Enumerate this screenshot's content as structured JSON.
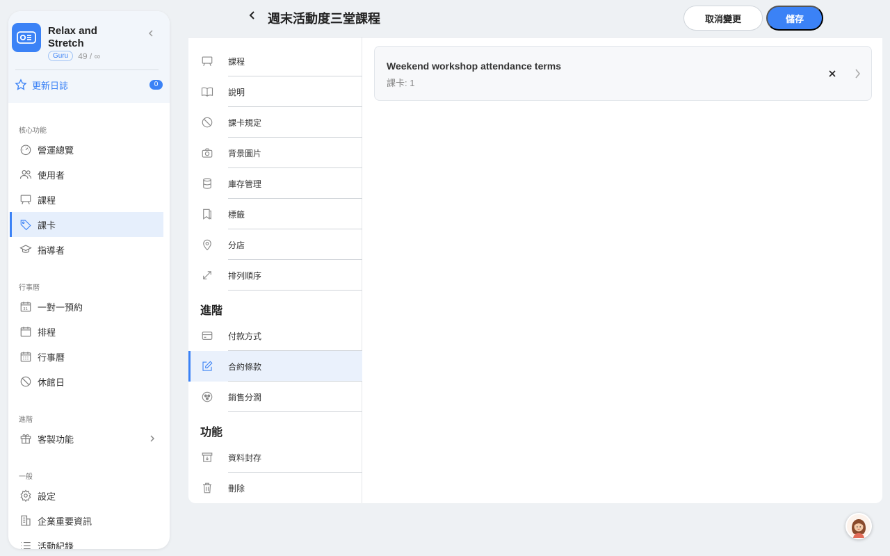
{
  "sidebar": {
    "app_name": "Relax and Stretch",
    "plan_badge": "Guru",
    "plan_count": "49 / ∞",
    "changelog_label": "更新日誌",
    "changelog_count": "0",
    "sections": {
      "core": "核心功能",
      "calendar": "行事曆",
      "advanced": "進階",
      "general": "一般"
    },
    "items": [
      {
        "label": "營運總覽",
        "icon": "dashboard-icon"
      },
      {
        "label": "使用者",
        "icon": "users-icon"
      },
      {
        "label": "課程",
        "icon": "presentation-icon"
      },
      {
        "label": "課卡",
        "icon": "tag-icon"
      },
      {
        "label": "指導者",
        "icon": "graduation-cap-icon"
      },
      {
        "label": "一對一預約",
        "icon": "calendar-31-icon"
      },
      {
        "label": "排程",
        "icon": "calendar-icon"
      },
      {
        "label": "行事曆",
        "icon": "calendar-grid-icon"
      },
      {
        "label": "休館日",
        "icon": "prohibited-icon"
      },
      {
        "label": "客製功能",
        "icon": "gift-icon"
      },
      {
        "label": "設定",
        "icon": "gear-icon"
      },
      {
        "label": "企業重要資訊",
        "icon": "building-icon"
      },
      {
        "label": "活動紀錄",
        "icon": "list-icon"
      }
    ]
  },
  "header": {
    "title": "週末活動度三堂課程",
    "cancel_label": "取消變更",
    "save_label": "儲存"
  },
  "settings_nav": {
    "items": [
      {
        "label": "課程",
        "icon": "presentation-icon"
      },
      {
        "label": "說明",
        "icon": "book-icon"
      },
      {
        "label": "課卡規定",
        "icon": "prohibited-icon"
      },
      {
        "label": "背景圖片",
        "icon": "camera-icon"
      },
      {
        "label": "庫存管理",
        "icon": "database-icon"
      },
      {
        "label": "標籤",
        "icon": "bookmark-icon"
      },
      {
        "label": "分店",
        "icon": "map-pin-icon"
      },
      {
        "label": "排列順序",
        "icon": "resize-icon"
      }
    ],
    "advanced_heading": "進階",
    "advanced_items": [
      {
        "label": "付款方式",
        "icon": "credit-card-icon"
      },
      {
        "label": "合約條款",
        "icon": "edit-icon"
      },
      {
        "label": "銷售分潤",
        "icon": "share-icon"
      }
    ],
    "functions_heading": "功能",
    "function_items": [
      {
        "label": "資料封存",
        "icon": "archive-icon"
      },
      {
        "label": "刪除",
        "icon": "trash-icon"
      }
    ]
  },
  "terms_card": {
    "title": "Weekend workshop attendance terms",
    "subtitle": "課卡: 1"
  },
  "colors": {
    "accent": "#3b82f6",
    "active_bg": "#e6effc",
    "page_bg": "#eef1f4"
  }
}
